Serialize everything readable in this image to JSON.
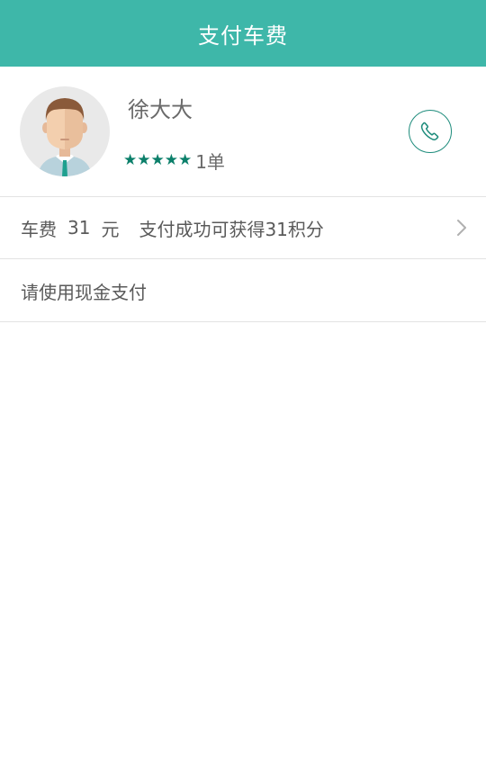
{
  "header": {
    "title": "支付车费"
  },
  "driver": {
    "name": "徐大大",
    "stars": "★★★★★",
    "orders": "1单",
    "avatar_icon": "driver-avatar",
    "call_icon": "phone-icon",
    "accent_color": "#3eb7a9"
  },
  "fare": {
    "label": "车费",
    "amount": "31",
    "unit": "元",
    "points_text": "支付成功可获得31积分"
  },
  "payment": {
    "note": "请使用现金支付"
  }
}
